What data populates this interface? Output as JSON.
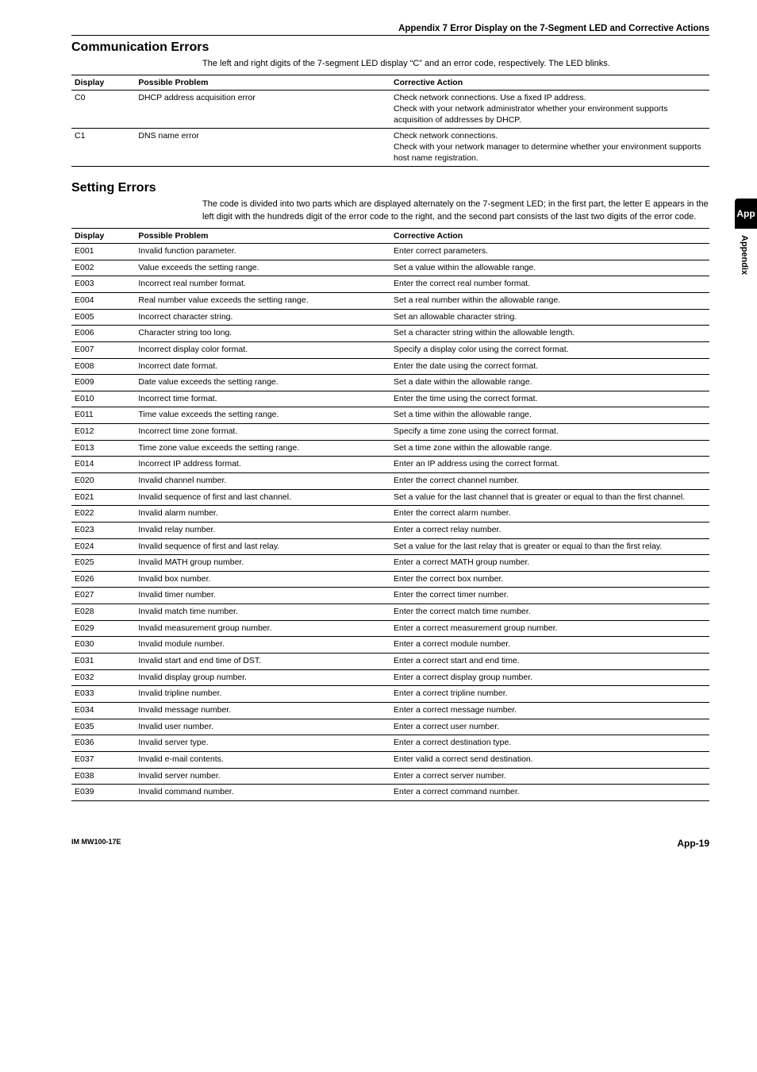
{
  "header": "Appendix 7  Error Display on the 7-Segment LED and Corrective Actions",
  "sidetab": {
    "top": "App",
    "bottom": "Appendix"
  },
  "footer": {
    "left": "IM MW100-17E",
    "right": "App-19"
  },
  "sections": {
    "comm": {
      "title": "Communication Errors",
      "intro": "The left and right digits of the 7-segment LED display “C” and an error code, respectively. The LED blinks.",
      "cols": [
        "Display",
        "Possible Problem",
        "Corrective Action"
      ],
      "rows": [
        {
          "d": "C0",
          "p": "DHCP address acquisition error",
          "a": "Check network connections.  Use a fixed IP address.\nCheck with your network administrator whether your environment supports acquisition of addresses by DHCP."
        },
        {
          "d": "C1",
          "p": "DNS name error",
          "a": "Check network connections.\nCheck with your network manager to determine whether your environment supports host name registration."
        }
      ]
    },
    "setting": {
      "title": "Setting Errors",
      "intro": "The code is divided into two parts which are displayed alternately on the 7-segment LED; in the first part, the letter E appears in the left digit with the hundreds digit of the error code to the right, and the second part consists of the last two digits of the error code.",
      "cols": [
        "Display",
        "Possible Problem",
        "Corrective Action"
      ],
      "rows": [
        {
          "d": "E001",
          "p": "Invalid function parameter.",
          "a": "Enter correct parameters."
        },
        {
          "d": "E002",
          "p": "Value exceeds the setting range.",
          "a": "Set a value within the allowable range."
        },
        {
          "d": "E003",
          "p": "Incorrect real number format.",
          "a": "Enter the correct real number format."
        },
        {
          "d": "E004",
          "p": "Real number value exceeds the setting range.",
          "a": "Set a real number within the allowable range."
        },
        {
          "d": "E005",
          "p": "Incorrect character string.",
          "a": "Set an allowable character string."
        },
        {
          "d": "E006",
          "p": "Character string too long.",
          "a": "Set a character string within the allowable length."
        },
        {
          "d": "E007",
          "p": "Incorrect display color format.",
          "a": "Specify a display color using the correct format."
        },
        {
          "d": "E008",
          "p": "Incorrect date format.",
          "a": "Enter the date using the correct format."
        },
        {
          "d": "E009",
          "p": "Date value exceeds the setting range.",
          "a": "Set a date within the allowable range."
        },
        {
          "d": "E010",
          "p": "Incorrect time format.",
          "a": "Enter the time using the correct format."
        },
        {
          "d": "E011",
          "p": "Time value exceeds the setting range.",
          "a": "Set a time within the allowable range."
        },
        {
          "d": "E012",
          "p": "Incorrect time zone format.",
          "a": "Specify a time zone using the correct format."
        },
        {
          "d": "E013",
          "p": "Time zone value exceeds the setting range.",
          "a": "Set a time zone within the allowable range."
        },
        {
          "d": "E014",
          "p": "Incorrect IP address format.",
          "a": "Enter an IP address using the correct format."
        },
        {
          "d": "E020",
          "p": "Invalid channel number.",
          "a": "Enter the correct channel number."
        },
        {
          "d": "E021",
          "p": "Invalid sequence of first and last channel.",
          "a": "Set a value for the last channel that is greater or equal to than the first channel."
        },
        {
          "d": "E022",
          "p": "Invalid alarm number.",
          "a": "Enter the correct alarm number."
        },
        {
          "d": "E023",
          "p": "Invalid relay number.",
          "a": "Enter a correct relay number."
        },
        {
          "d": "E024",
          "p": "Invalid sequence of first and last relay.",
          "a": "Set a value for the last relay that is greater or equal to than the first relay."
        },
        {
          "d": "E025",
          "p": "Invalid MATH group number.",
          "a": "Enter a correct MATH group number."
        },
        {
          "d": "E026",
          "p": "Invalid box number.",
          "a": "Enter the correct box number."
        },
        {
          "d": "E027",
          "p": "Invalid timer number.",
          "a": "Enter the correct timer number."
        },
        {
          "d": "E028",
          "p": "Invalid match time number.",
          "a": "Enter the correct match time number."
        },
        {
          "d": "E029",
          "p": "Invalid measurement group number.",
          "a": "Enter a correct measurement group number."
        },
        {
          "d": "E030",
          "p": "Invalid module number.",
          "a": "Enter a correct module number."
        },
        {
          "d": "E031",
          "p": "Invalid start and end time of DST.",
          "a": "Enter a correct start and end time."
        },
        {
          "d": "E032",
          "p": "Invalid display group number.",
          "a": "Enter a correct display group number."
        },
        {
          "d": "E033",
          "p": "Invalid tripline number.",
          "a": "Enter a correct tripline number."
        },
        {
          "d": "E034",
          "p": "Invalid message number.",
          "a": "Enter a correct message number."
        },
        {
          "d": "E035",
          "p": "Invalid user number.",
          "a": "Enter a correct user number."
        },
        {
          "d": "E036",
          "p": "Invalid server type.",
          "a": "Enter a correct destination type."
        },
        {
          "d": "E037",
          "p": "Invalid e-mail contents.",
          "a": "Enter valid a correct send destination."
        },
        {
          "d": "E038",
          "p": "Invalid server number.",
          "a": "Enter a correct server number."
        },
        {
          "d": "E039",
          "p": "Invalid command number.",
          "a": "Enter a correct command number."
        }
      ]
    }
  }
}
